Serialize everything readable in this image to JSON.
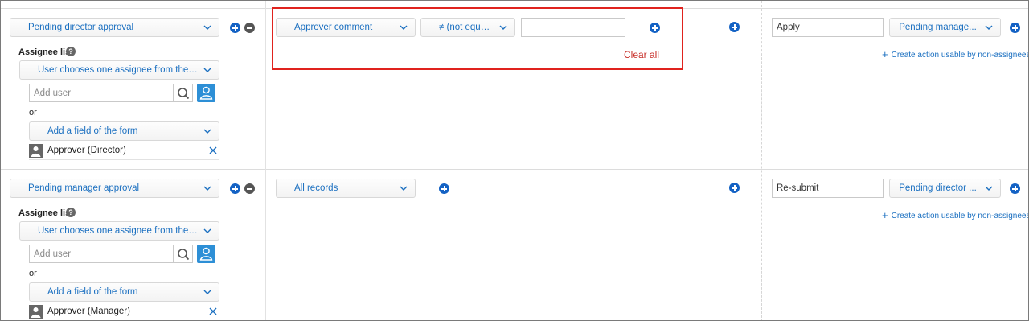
{
  "rows": [
    {
      "status": "Pending director approval",
      "assignee_label": "Assignee list",
      "assignee_mode": "User chooses one assignee from the list t...",
      "add_user_placeholder": "Add user",
      "or_label": "or",
      "add_field_label": "Add a field of the form",
      "assignee": "Approver (Director)",
      "condition_field": "Approver comment",
      "condition_operator": "≠ (not equal to)",
      "condition_value": "",
      "clear_all": "Clear all",
      "action_name": "Apply",
      "next_status": "Pending manage...",
      "create_action": "Create action usable by non-assignees"
    },
    {
      "status": "Pending manager approval",
      "assignee_label": "Assignee list",
      "assignee_mode": "User chooses one assignee from the list t...",
      "add_user_placeholder": "Add user",
      "or_label": "or",
      "add_field_label": "Add a field of the form",
      "assignee": "Approver (Manager)",
      "condition_field": "All records",
      "action_name": "Re-submit",
      "next_status": "Pending director ...",
      "create_action": "Create action usable by non-assignees"
    }
  ],
  "colors": {
    "accent": "#1a6fc0",
    "highlight": "#e0231e",
    "clear_all": "#c8302a",
    "add_button": "#1462c4"
  },
  "icons": [
    "chevron-down-icon",
    "plus-circle-icon",
    "minus-circle-icon",
    "help-icon",
    "search-icon",
    "user-icon",
    "close-icon"
  ]
}
